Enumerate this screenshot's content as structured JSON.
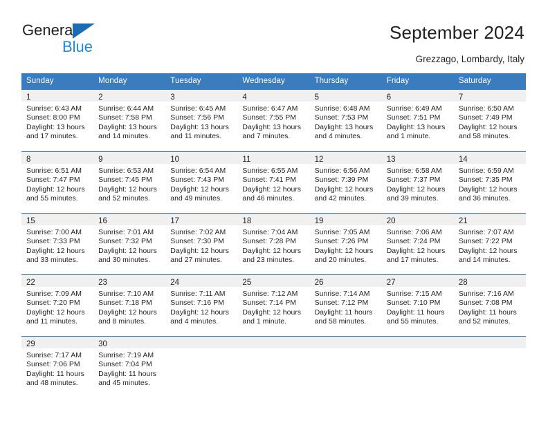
{
  "brand": {
    "name_top": "General",
    "name_bottom": "Blue",
    "accent_color": "#2389d6",
    "triangle_color": "#1b6cb5"
  },
  "header": {
    "title": "September 2024",
    "location": "Grezzago, Lombardy, Italy"
  },
  "calendar": {
    "header_bg": "#3a7cbe",
    "daynum_bg": "#f0f0f0",
    "row_border_color": "#2f6fab",
    "weekdays": [
      "Sunday",
      "Monday",
      "Tuesday",
      "Wednesday",
      "Thursday",
      "Friday",
      "Saturday"
    ],
    "labels": {
      "sunrise": "Sunrise:",
      "sunset": "Sunset:",
      "daylight": "Daylight:"
    },
    "weeks": [
      [
        {
          "day": "1",
          "sunrise": "Sunrise: 6:43 AM",
          "sunset": "Sunset: 8:00 PM",
          "daylight_1": "Daylight: 13 hours",
          "daylight_2": "and 17 minutes."
        },
        {
          "day": "2",
          "sunrise": "Sunrise: 6:44 AM",
          "sunset": "Sunset: 7:58 PM",
          "daylight_1": "Daylight: 13 hours",
          "daylight_2": "and 14 minutes."
        },
        {
          "day": "3",
          "sunrise": "Sunrise: 6:45 AM",
          "sunset": "Sunset: 7:56 PM",
          "daylight_1": "Daylight: 13 hours",
          "daylight_2": "and 11 minutes."
        },
        {
          "day": "4",
          "sunrise": "Sunrise: 6:47 AM",
          "sunset": "Sunset: 7:55 PM",
          "daylight_1": "Daylight: 13 hours",
          "daylight_2": "and 7 minutes."
        },
        {
          "day": "5",
          "sunrise": "Sunrise: 6:48 AM",
          "sunset": "Sunset: 7:53 PM",
          "daylight_1": "Daylight: 13 hours",
          "daylight_2": "and 4 minutes."
        },
        {
          "day": "6",
          "sunrise": "Sunrise: 6:49 AM",
          "sunset": "Sunset: 7:51 PM",
          "daylight_1": "Daylight: 13 hours",
          "daylight_2": "and 1 minute."
        },
        {
          "day": "7",
          "sunrise": "Sunrise: 6:50 AM",
          "sunset": "Sunset: 7:49 PM",
          "daylight_1": "Daylight: 12 hours",
          "daylight_2": "and 58 minutes."
        }
      ],
      [
        {
          "day": "8",
          "sunrise": "Sunrise: 6:51 AM",
          "sunset": "Sunset: 7:47 PM",
          "daylight_1": "Daylight: 12 hours",
          "daylight_2": "and 55 minutes."
        },
        {
          "day": "9",
          "sunrise": "Sunrise: 6:53 AM",
          "sunset": "Sunset: 7:45 PM",
          "daylight_1": "Daylight: 12 hours",
          "daylight_2": "and 52 minutes."
        },
        {
          "day": "10",
          "sunrise": "Sunrise: 6:54 AM",
          "sunset": "Sunset: 7:43 PM",
          "daylight_1": "Daylight: 12 hours",
          "daylight_2": "and 49 minutes."
        },
        {
          "day": "11",
          "sunrise": "Sunrise: 6:55 AM",
          "sunset": "Sunset: 7:41 PM",
          "daylight_1": "Daylight: 12 hours",
          "daylight_2": "and 46 minutes."
        },
        {
          "day": "12",
          "sunrise": "Sunrise: 6:56 AM",
          "sunset": "Sunset: 7:39 PM",
          "daylight_1": "Daylight: 12 hours",
          "daylight_2": "and 42 minutes."
        },
        {
          "day": "13",
          "sunrise": "Sunrise: 6:58 AM",
          "sunset": "Sunset: 7:37 PM",
          "daylight_1": "Daylight: 12 hours",
          "daylight_2": "and 39 minutes."
        },
        {
          "day": "14",
          "sunrise": "Sunrise: 6:59 AM",
          "sunset": "Sunset: 7:35 PM",
          "daylight_1": "Daylight: 12 hours",
          "daylight_2": "and 36 minutes."
        }
      ],
      [
        {
          "day": "15",
          "sunrise": "Sunrise: 7:00 AM",
          "sunset": "Sunset: 7:33 PM",
          "daylight_1": "Daylight: 12 hours",
          "daylight_2": "and 33 minutes."
        },
        {
          "day": "16",
          "sunrise": "Sunrise: 7:01 AM",
          "sunset": "Sunset: 7:32 PM",
          "daylight_1": "Daylight: 12 hours",
          "daylight_2": "and 30 minutes."
        },
        {
          "day": "17",
          "sunrise": "Sunrise: 7:02 AM",
          "sunset": "Sunset: 7:30 PM",
          "daylight_1": "Daylight: 12 hours",
          "daylight_2": "and 27 minutes."
        },
        {
          "day": "18",
          "sunrise": "Sunrise: 7:04 AM",
          "sunset": "Sunset: 7:28 PM",
          "daylight_1": "Daylight: 12 hours",
          "daylight_2": "and 23 minutes."
        },
        {
          "day": "19",
          "sunrise": "Sunrise: 7:05 AM",
          "sunset": "Sunset: 7:26 PM",
          "daylight_1": "Daylight: 12 hours",
          "daylight_2": "and 20 minutes."
        },
        {
          "day": "20",
          "sunrise": "Sunrise: 7:06 AM",
          "sunset": "Sunset: 7:24 PM",
          "daylight_1": "Daylight: 12 hours",
          "daylight_2": "and 17 minutes."
        },
        {
          "day": "21",
          "sunrise": "Sunrise: 7:07 AM",
          "sunset": "Sunset: 7:22 PM",
          "daylight_1": "Daylight: 12 hours",
          "daylight_2": "and 14 minutes."
        }
      ],
      [
        {
          "day": "22",
          "sunrise": "Sunrise: 7:09 AM",
          "sunset": "Sunset: 7:20 PM",
          "daylight_1": "Daylight: 12 hours",
          "daylight_2": "and 11 minutes."
        },
        {
          "day": "23",
          "sunrise": "Sunrise: 7:10 AM",
          "sunset": "Sunset: 7:18 PM",
          "daylight_1": "Daylight: 12 hours",
          "daylight_2": "and 8 minutes."
        },
        {
          "day": "24",
          "sunrise": "Sunrise: 7:11 AM",
          "sunset": "Sunset: 7:16 PM",
          "daylight_1": "Daylight: 12 hours",
          "daylight_2": "and 4 minutes."
        },
        {
          "day": "25",
          "sunrise": "Sunrise: 7:12 AM",
          "sunset": "Sunset: 7:14 PM",
          "daylight_1": "Daylight: 12 hours",
          "daylight_2": "and 1 minute."
        },
        {
          "day": "26",
          "sunrise": "Sunrise: 7:14 AM",
          "sunset": "Sunset: 7:12 PM",
          "daylight_1": "Daylight: 11 hours",
          "daylight_2": "and 58 minutes."
        },
        {
          "day": "27",
          "sunrise": "Sunrise: 7:15 AM",
          "sunset": "Sunset: 7:10 PM",
          "daylight_1": "Daylight: 11 hours",
          "daylight_2": "and 55 minutes."
        },
        {
          "day": "28",
          "sunrise": "Sunrise: 7:16 AM",
          "sunset": "Sunset: 7:08 PM",
          "daylight_1": "Daylight: 11 hours",
          "daylight_2": "and 52 minutes."
        }
      ],
      [
        {
          "day": "29",
          "sunrise": "Sunrise: 7:17 AM",
          "sunset": "Sunset: 7:06 PM",
          "daylight_1": "Daylight: 11 hours",
          "daylight_2": "and 48 minutes."
        },
        {
          "day": "30",
          "sunrise": "Sunrise: 7:19 AM",
          "sunset": "Sunset: 7:04 PM",
          "daylight_1": "Daylight: 11 hours",
          "daylight_2": "and 45 minutes."
        },
        {
          "day": "",
          "sunrise": "",
          "sunset": "",
          "daylight_1": "",
          "daylight_2": ""
        },
        {
          "day": "",
          "sunrise": "",
          "sunset": "",
          "daylight_1": "",
          "daylight_2": ""
        },
        {
          "day": "",
          "sunrise": "",
          "sunset": "",
          "daylight_1": "",
          "daylight_2": ""
        },
        {
          "day": "",
          "sunrise": "",
          "sunset": "",
          "daylight_1": "",
          "daylight_2": ""
        },
        {
          "day": "",
          "sunrise": "",
          "sunset": "",
          "daylight_1": "",
          "daylight_2": ""
        }
      ]
    ]
  }
}
